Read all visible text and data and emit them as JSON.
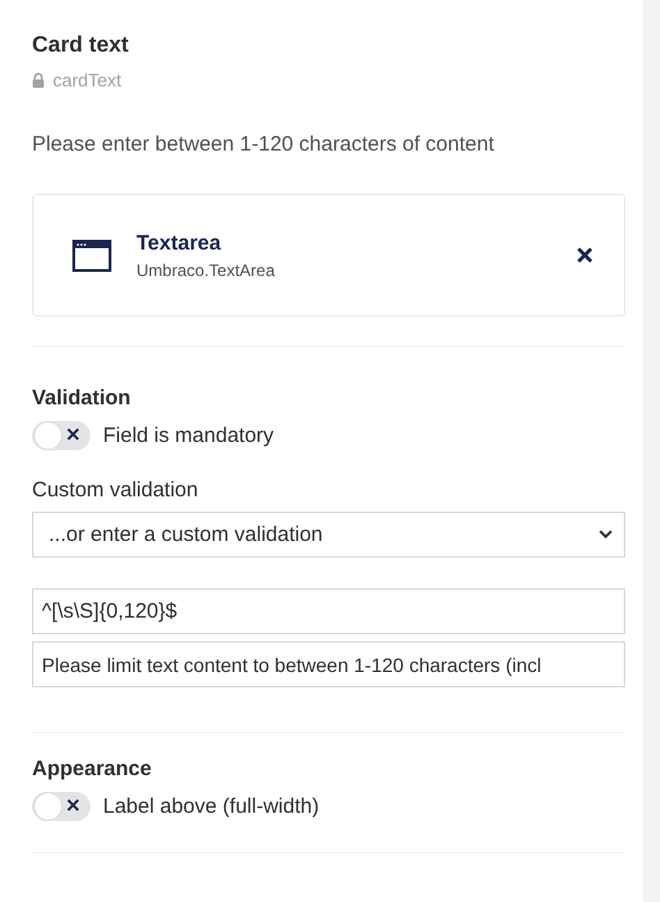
{
  "property": {
    "name": "Card text",
    "alias": "cardText",
    "description": "Please enter between 1-120 characters of content"
  },
  "editor": {
    "name": "Textarea",
    "alias": "Umbraco.TextArea"
  },
  "validation": {
    "heading": "Validation",
    "mandatory": {
      "label": "Field is mandatory",
      "on": false
    },
    "custom_label": "Custom validation",
    "select": {
      "value": "...or enter a custom validation"
    },
    "pattern": {
      "value": "^[\\s\\S]{0,120}$"
    },
    "message": {
      "value": "Please limit text content to between 1-120 characters (incl"
    }
  },
  "appearance": {
    "heading": "Appearance",
    "label_above": {
      "label": "Label above (full-width)",
      "on": false
    }
  }
}
